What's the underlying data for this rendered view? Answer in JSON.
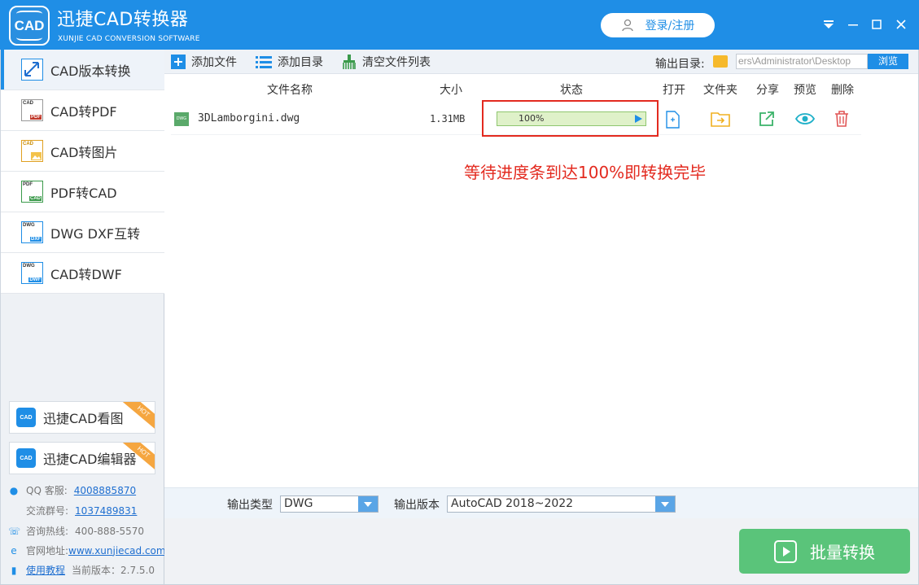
{
  "titlebar": {
    "app_name": "迅捷CAD转换器",
    "app_subtitle": "XUNJIE CAD CONVERSION SOFTWARE",
    "logo_text": "CAD",
    "login_label": "登录/注册"
  },
  "sidebar": {
    "items": [
      {
        "label": "CAD版本转换",
        "icon": "cad-version-icon",
        "active": true
      },
      {
        "label": "CAD转PDF",
        "icon": "cad-to-pdf-icon",
        "active": false
      },
      {
        "label": "CAD转图片",
        "icon": "cad-to-image-icon",
        "active": false
      },
      {
        "label": "PDF转CAD",
        "icon": "pdf-to-cad-icon",
        "active": false
      },
      {
        "label": "DWG DXF互转",
        "icon": "dwg-dxf-icon",
        "active": false
      },
      {
        "label": "CAD转DWF",
        "icon": "cad-to-dwf-icon",
        "active": false
      }
    ],
    "promos": [
      {
        "label": "迅捷CAD看图",
        "badge": "HOT"
      },
      {
        "label": "迅捷CAD编辑器",
        "badge": "HOT"
      }
    ],
    "info": {
      "qq_label": "QQ 客服:",
      "qq_value": "4008885870",
      "group_label": "交流群号:",
      "group_value": "1037489831",
      "hotline_label": "咨询热线:",
      "hotline_value": "400-888-5570",
      "site_label": "官网地址:",
      "site_value": "www.xunjiecad.com",
      "tutorial_label": "使用教程",
      "version_label": "当前版本：",
      "version_value": "2.7.5.0"
    }
  },
  "toolbar": {
    "add_file": "添加文件",
    "add_dir": "添加目录",
    "clear_list": "清空文件列表",
    "output_dir_label": "输出目录:",
    "output_dir_value": "ers\\Administrator\\Desktop",
    "browse": "浏览"
  },
  "table": {
    "headers": {
      "name": "文件名称",
      "size": "大小",
      "status": "状态",
      "open": "打开",
      "folder": "文件夹",
      "share": "分享",
      "preview": "预览",
      "delete": "删除"
    },
    "rows": [
      {
        "file_type": "DWG",
        "name": "3DLamborgini.dwg",
        "size": "1.31MB",
        "progress": 100,
        "progress_text": "100%"
      }
    ]
  },
  "annotation": {
    "text": "等待进度条到达100%即转换完毕",
    "color": "#e32a1f"
  },
  "settings": {
    "output_type_label": "输出类型",
    "output_type_value": "DWG",
    "output_version_label": "输出版本",
    "output_version_value": "AutoCAD 2018~2022"
  },
  "convert_button": "批量转换",
  "colors": {
    "accent": "#1f8ee6",
    "convert": "#5ac47a",
    "progress_fill": "#dff1c9",
    "highlight": "#e32a1f"
  }
}
